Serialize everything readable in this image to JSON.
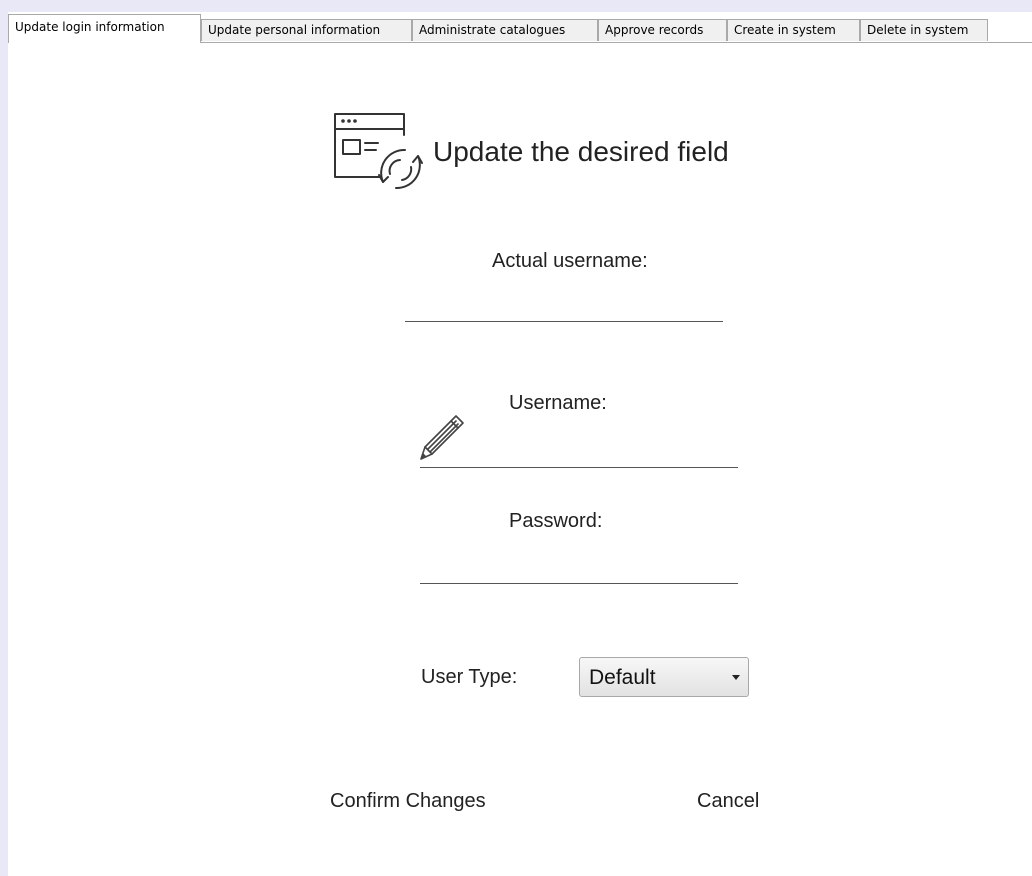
{
  "tabs": [
    {
      "label": "Update login information",
      "active": true
    },
    {
      "label": "Update personal information",
      "active": false
    },
    {
      "label": "Administrate catalogues",
      "active": false
    },
    {
      "label": "Approve records",
      "active": false
    },
    {
      "label": "Create in system",
      "active": false
    },
    {
      "label": "Delete in system",
      "active": false
    }
  ],
  "header": {
    "title": "Update the desired field",
    "icon": "window-refresh-icon"
  },
  "form": {
    "actual_username_label": "Actual username:",
    "actual_username_value": "",
    "username_label": "Username:",
    "username_value": "",
    "username_icon": "pencil-icon",
    "password_label": "Password:",
    "password_value": "",
    "user_type_label": "User Type:",
    "user_type_selected": "Default"
  },
  "actions": {
    "confirm_label": "Confirm Changes",
    "cancel_label": "Cancel"
  },
  "colors": {
    "chrome_background": "#e8e8f7",
    "tab_border": "#a9a9a9",
    "text": "#222222"
  }
}
